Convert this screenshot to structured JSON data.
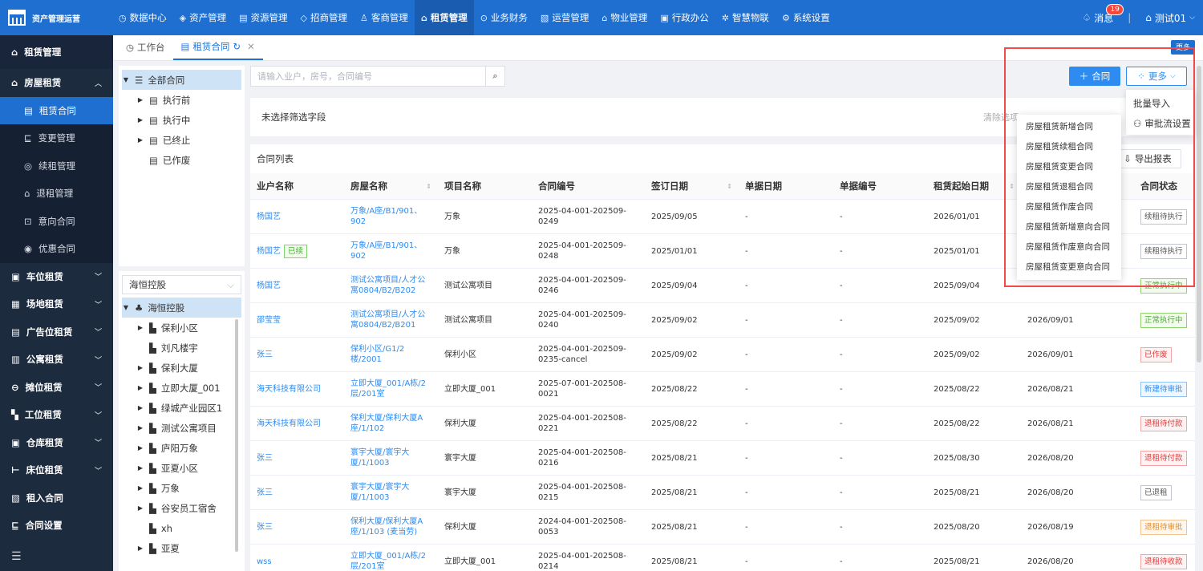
{
  "app": {
    "title": "资产管理运营"
  },
  "nav": [
    {
      "icon": "◷",
      "label": "数据中心"
    },
    {
      "icon": "◈",
      "label": "资产管理"
    },
    {
      "icon": "▤",
      "label": "资源管理"
    },
    {
      "icon": "◇",
      "label": "招商管理"
    },
    {
      "icon": "♙",
      "label": "客商管理"
    },
    {
      "icon": "⌂",
      "label": "租赁管理"
    },
    {
      "icon": "⊙",
      "label": "业务财务"
    },
    {
      "icon": "▧",
      "label": "运营管理"
    },
    {
      "icon": "⌂",
      "label": "物业管理"
    },
    {
      "icon": "▣",
      "label": "行政办公"
    },
    {
      "icon": "✲",
      "label": "智慧物联"
    },
    {
      "icon": "⚙",
      "label": "系统设置"
    }
  ],
  "header": {
    "messages_label": "消息",
    "message_count": "19",
    "user_label": "测试01"
  },
  "sidebar": {
    "title": "租赁管理",
    "group": "房屋租赁",
    "subitems": [
      {
        "icon": "▤",
        "label": "租赁合同"
      },
      {
        "icon": "⊑",
        "label": "变更管理"
      },
      {
        "icon": "◎",
        "label": "续租管理"
      },
      {
        "icon": "⌂",
        "label": "退租管理"
      },
      {
        "icon": "⊡",
        "label": "意向合同"
      },
      {
        "icon": "◉",
        "label": "优惠合同"
      }
    ],
    "groups": [
      {
        "icon": "▣",
        "label": "车位租赁"
      },
      {
        "icon": "▦",
        "label": "场地租赁"
      },
      {
        "icon": "▤",
        "label": "广告位租赁"
      },
      {
        "icon": "▥",
        "label": "公寓租赁"
      },
      {
        "icon": "⊖",
        "label": "摊位租赁"
      },
      {
        "icon": "▚",
        "label": "工位租赁"
      },
      {
        "icon": "▣",
        "label": "仓库租赁"
      },
      {
        "icon": "⊢",
        "label": "床位租赁"
      },
      {
        "icon": "▧",
        "label": "租入合同"
      },
      {
        "icon": "⊑",
        "label": "合同设置"
      }
    ]
  },
  "tabs": [
    {
      "icon": "◷",
      "label": "工作台"
    },
    {
      "icon": "▤",
      "label": "租赁合同"
    }
  ],
  "top_more_label": "更多",
  "tree_top": {
    "root": "全部合同",
    "items": [
      "执行前",
      "执行中",
      "已终止",
      "已作废"
    ]
  },
  "tree_bottom": {
    "select_value": "海恒控股",
    "root": "海恒控股",
    "items": [
      "保利小区",
      "刘凡楼宇",
      "保利大厦",
      "立即大厦_001",
      "绿城产业园区1",
      "测试公寓项目",
      "庐阳万象",
      "亚夏小区",
      "万象",
      "谷安员工宿舍",
      "xh",
      "亚夏"
    ]
  },
  "search": {
    "placeholder": "请输入业户，房号，合同编号"
  },
  "buttons": {
    "add": "合同",
    "more": "更多",
    "export": "导出报表"
  },
  "filter": {
    "text": "未选择筛选字段",
    "clear": "清除选项"
  },
  "list_title": "合同列表",
  "dropdown": {
    "items": [
      "批量导入",
      "审批流设置"
    ]
  },
  "submenu": {
    "items": [
      "房屋租赁新增合同",
      "房屋租赁续租合同",
      "房屋租赁变更合同",
      "房屋租赁退租合同",
      "房屋租赁作废合同",
      "房屋租赁新增意向合同",
      "房屋租赁作废意向合同",
      "房屋租赁变更意向合同"
    ]
  },
  "table": {
    "columns": [
      "业户名称",
      "房屋名称",
      "项目名称",
      "合同编号",
      "签订日期",
      "单据日期",
      "单据编号",
      "租赁起始日期",
      "",
      "合同状态"
    ],
    "tag_renew": "已续",
    "rows": [
      {
        "tenant": "杨国艺",
        "room": "万象/A座/B1/901、902",
        "project": "万象",
        "code": "2025-04-001-202509-0249",
        "sign": "2025/09/05",
        "doc_date": "-",
        "doc_no": "-",
        "start": "2026/01/01",
        "end": "",
        "status": "续租待执行",
        "color": "gray",
        "renew": false
      },
      {
        "tenant": "杨国艺",
        "room": "万象/A座/B1/901、902",
        "project": "万象",
        "code": "2025-04-001-202509-0248",
        "sign": "2025/01/01",
        "doc_date": "-",
        "doc_no": "-",
        "start": "2025/01/01",
        "end": "",
        "status": "续租待执行",
        "color": "gray",
        "renew": true
      },
      {
        "tenant": "杨国艺",
        "room": "测试公寓项目/人才公寓0804/B2/B202",
        "project": "测试公寓项目",
        "code": "2025-04-001-202509-0246",
        "sign": "2025/09/04",
        "doc_date": "-",
        "doc_no": "-",
        "start": "2025/09/04",
        "end": "",
        "status": "正常执行中",
        "color": "green",
        "renew": false
      },
      {
        "tenant": "邵莹莹",
        "room": "测试公寓项目/人才公寓0804/B2/B201",
        "project": "测试公寓项目",
        "code": "2025-04-001-202509-0240",
        "sign": "2025/09/02",
        "doc_date": "-",
        "doc_no": "-",
        "start": "2025/09/02",
        "end": "2026/09/01",
        "status": "正常执行中",
        "color": "green",
        "renew": false
      },
      {
        "tenant": "张三",
        "room": "保利小区/G1/2楼/2001",
        "project": "保利小区",
        "code": "2025-04-001-202509-0235-cancel",
        "sign": "2025/09/02",
        "doc_date": "-",
        "doc_no": "-",
        "start": "2025/09/02",
        "end": "2026/09/01",
        "status": "已作废",
        "color": "red",
        "renew": false
      },
      {
        "tenant": "海天科技有限公司",
        "room": "立即大厦_001/A栋/2层/201室",
        "project": "立即大厦_001",
        "code": "2025-07-001-202508-0021",
        "sign": "2025/08/22",
        "doc_date": "-",
        "doc_no": "-",
        "start": "2025/08/22",
        "end": "2026/08/21",
        "status": "新建待审批",
        "color": "blue",
        "renew": false
      },
      {
        "tenant": "海天科技有限公司",
        "room": "保利大厦/保利大厦A座/1/102",
        "project": "保利大厦",
        "code": "2025-04-001-202508-0221",
        "sign": "2025/08/22",
        "doc_date": "-",
        "doc_no": "-",
        "start": "2025/08/22",
        "end": "2026/08/21",
        "status": "退租待付款",
        "color": "red",
        "renew": false
      },
      {
        "tenant": "张三",
        "room": "寰宇大厦/寰宇大厦/1/1003",
        "project": "寰宇大厦",
        "code": "2025-04-001-202508-0216",
        "sign": "2025/08/21",
        "doc_date": "-",
        "doc_no": "-",
        "start": "2025/08/30",
        "end": "2026/08/20",
        "status": "退租待付款",
        "color": "red",
        "renew": false
      },
      {
        "tenant": "张三",
        "room": "寰宇大厦/寰宇大厦/1/1003",
        "project": "寰宇大厦",
        "code": "2025-04-001-202508-0215",
        "sign": "2025/08/21",
        "doc_date": "-",
        "doc_no": "-",
        "start": "2025/08/21",
        "end": "2026/08/20",
        "status": "已退租",
        "color": "gray",
        "renew": false
      },
      {
        "tenant": "张三",
        "room": "保利大厦/保利大厦A座/1/103 (麦当劳)",
        "project": "保利大厦",
        "code": "2024-04-001-202508-0053",
        "sign": "2025/08/21",
        "doc_date": "-",
        "doc_no": "-",
        "start": "2025/08/20",
        "end": "2026/08/19",
        "status": "退租待审批",
        "color": "orange",
        "renew": false
      },
      {
        "tenant": "wss",
        "room": "立即大厦_001/A栋/2层/201室",
        "project": "立即大厦_001",
        "code": "2025-04-001-202508-0214",
        "sign": "2025/08/21",
        "doc_date": "-",
        "doc_no": "-",
        "start": "2025/08/21",
        "end": "2026/08/20",
        "status": "退租待收款",
        "color": "red",
        "renew": false
      }
    ]
  }
}
